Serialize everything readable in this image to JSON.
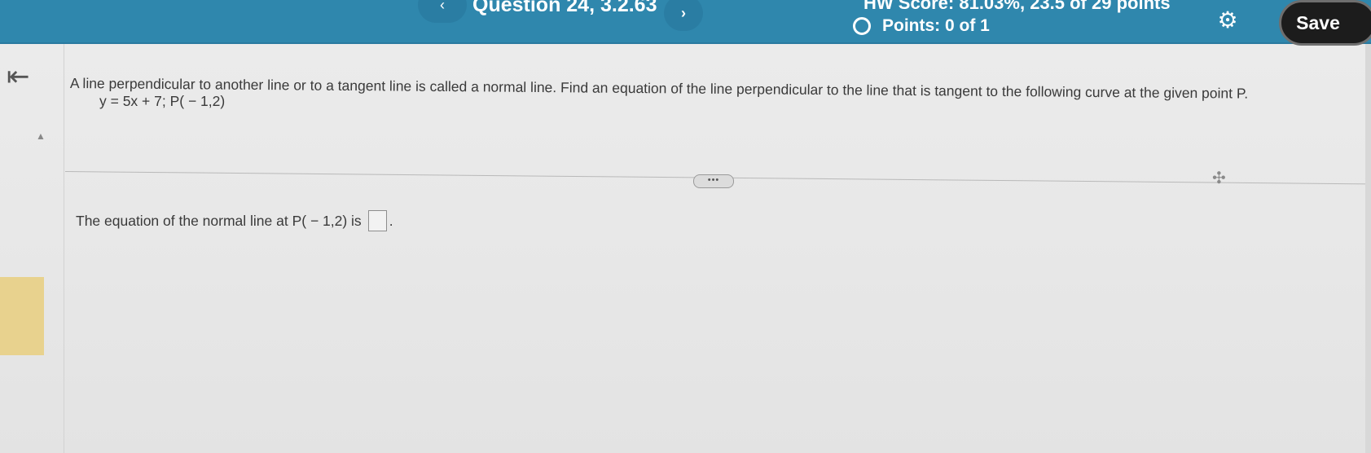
{
  "header": {
    "prev_label": "‹",
    "question_title": "Question 24, 3.2.63",
    "next_label": "›",
    "hw_score": "HW Score: 81.03%, 23.5 of 29 points",
    "points": "Points: 0 of 1",
    "save_label": "Save"
  },
  "icons": {
    "collapse": "⇤",
    "gear": "⚙",
    "up_triangle": "▲",
    "move": "✣",
    "more": "•••"
  },
  "question": {
    "prompt": "A line perpendicular to another line or to a tangent line is called a normal line. Find an equation of the line perpendicular to the line that is tangent to the following curve at the given point P.",
    "equation": "y = 5x + 7; P( − 1,2)",
    "answer_prefix": "The equation of the normal line at P( − 1,2) is",
    "answer_suffix": "."
  },
  "colors": {
    "header": "#2f87ad",
    "save_button": "#1c1c1c",
    "side_tab": "#e8d28e"
  }
}
